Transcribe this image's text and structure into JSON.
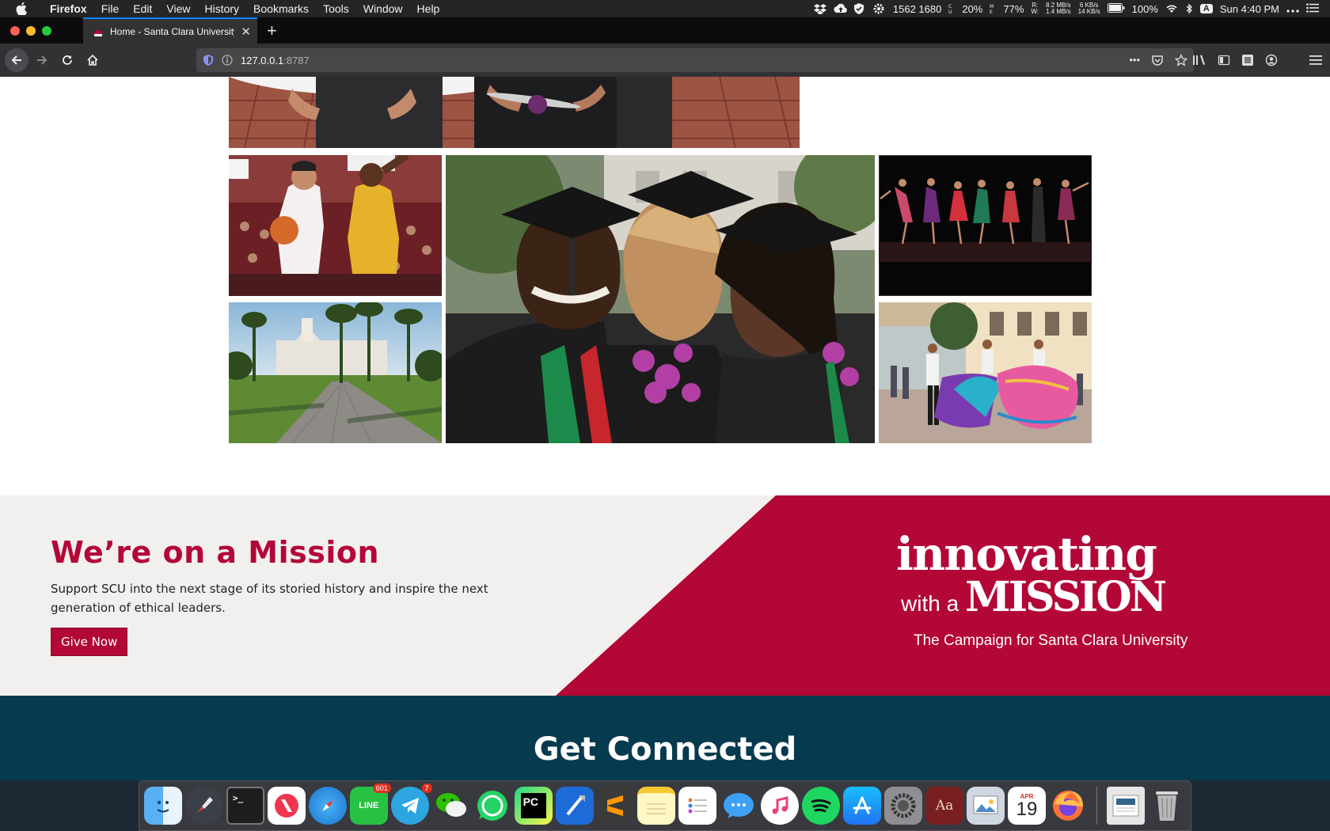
{
  "menubar": {
    "app_name": "Firefox",
    "items": [
      "File",
      "Edit",
      "View",
      "History",
      "Bookmarks",
      "Tools",
      "Window",
      "Help"
    ],
    "status": {
      "screen_res": "1562 1680",
      "cpu": "20%",
      "memory": "77%",
      "disk_r": "R:",
      "disk_w": "W:",
      "disk_io_top": "8.2 MB/s",
      "disk_io_bottom": "1.4 MB/s",
      "net_top": "6 KB/s",
      "net_bottom": "14 KB/s",
      "battery": "100%",
      "input_source": "A",
      "clock": "Sun 4:40 PM"
    }
  },
  "browser": {
    "tab_title": "Home - Santa Clara University",
    "url_host": "127.0.0.1",
    "url_port": ":8787"
  },
  "page": {
    "mission": {
      "heading": "We’re on a Mission",
      "body": "Support SCU into the next stage of its storied history and inspire the next generation of ethical leaders.",
      "button": "Give Now",
      "logo_line1": "innovating",
      "logo_with_a": "with a",
      "logo_line2": "MISSION",
      "logo_tagline": "The Campaign for Santa Clara University"
    },
    "connected": {
      "heading": "Get Connected"
    }
  },
  "dock": {
    "line_badge": "601",
    "telegram_badge": "7",
    "calendar_month": "APR",
    "calendar_day": "19"
  }
}
